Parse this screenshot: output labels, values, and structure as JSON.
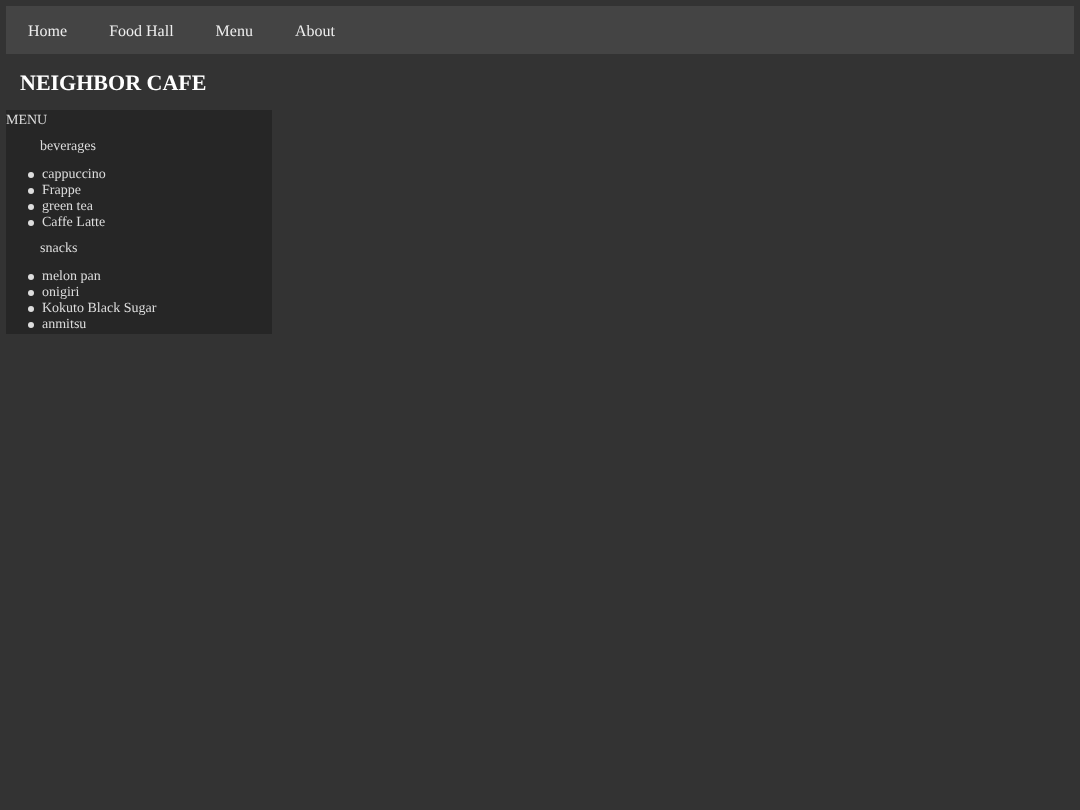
{
  "nav": [
    {
      "label": "Home"
    },
    {
      "label": "Food Hall"
    },
    {
      "label": "Menu"
    },
    {
      "label": "About"
    }
  ],
  "site_title": "NEIGHBOR CAFE",
  "menu": {
    "heading": "MENU",
    "sections": [
      {
        "title": "beverages",
        "items": [
          "cappuccino",
          "Frappe",
          "green tea",
          "Caffe Latte"
        ]
      },
      {
        "title": "snacks",
        "items": [
          "melon pan",
          "onigiri",
          "Kokuto Black Sugar",
          "anmitsu"
        ]
      }
    ]
  }
}
